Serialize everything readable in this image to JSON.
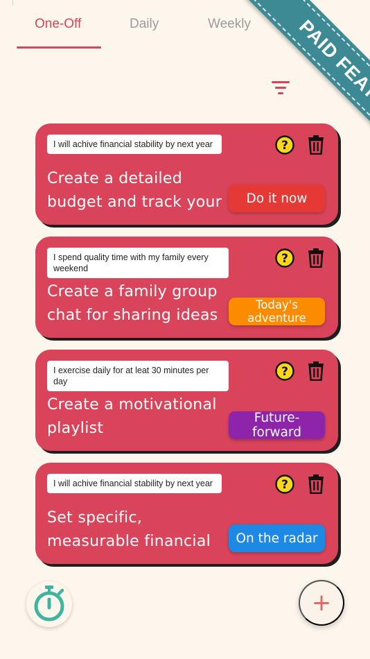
{
  "tabs": [
    {
      "label": "One-Off",
      "active": true
    },
    {
      "label": "Daily",
      "active": false
    },
    {
      "label": "Weekly",
      "active": false
    }
  ],
  "ribbon": {
    "text": "PAID FEATURE",
    "color": "#3e8a94"
  },
  "toolbar": {
    "filter_icon": "filter-icon"
  },
  "cards": [
    {
      "goal": "I will achive financial stability by next year",
      "task": "Create a detailed budget and track your",
      "action": "Do it now",
      "action_color": "#e53935"
    },
    {
      "goal": "I spend quality time with my family every weekend",
      "task": "Create a family group chat for sharing ideas",
      "action": "Today's adventure",
      "action_color": "#fb8c00"
    },
    {
      "goal": "I exercise daily for at leat 30 minutes per day",
      "task": "Create a motivational playlist",
      "action": "Future-forward",
      "action_color": "#8e24aa"
    },
    {
      "goal": "I will achive financial stability by next year",
      "task": "Set specific, measurable financial",
      "action": "On the radar",
      "action_color": "#1e88e5"
    }
  ],
  "fab": {
    "add_label": "+",
    "timer_icon": "stopwatch-icon"
  },
  "colors": {
    "card": "#d9445a",
    "accent": "#d9445a",
    "background": "#fdf6ec",
    "timer": "#3fb5a0"
  }
}
